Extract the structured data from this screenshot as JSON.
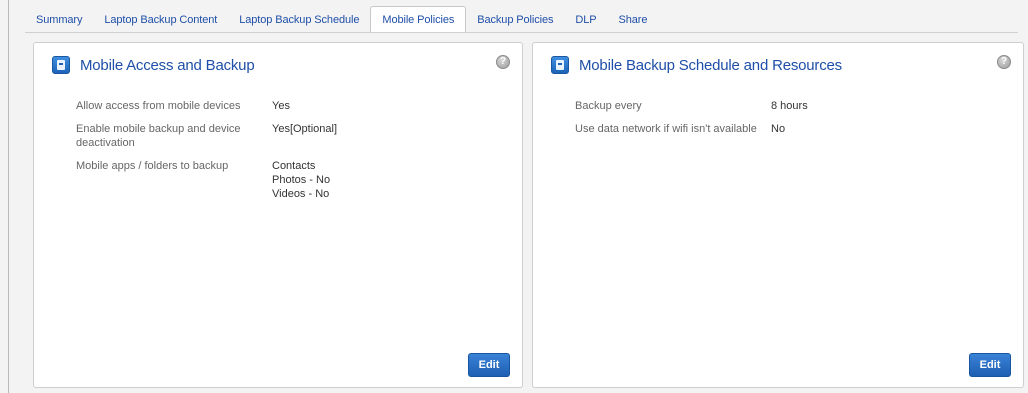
{
  "tabs": [
    {
      "label": "Summary",
      "active": false
    },
    {
      "label": "Laptop Backup Content",
      "active": false
    },
    {
      "label": "Laptop Backup Schedule",
      "active": false
    },
    {
      "label": "Mobile Policies",
      "active": true
    },
    {
      "label": "Backup Policies",
      "active": false
    },
    {
      "label": "DLP",
      "active": false
    },
    {
      "label": "Share",
      "active": false
    }
  ],
  "left_panel": {
    "title": "Mobile Access and Backup",
    "help_glyph": "?",
    "rows": [
      {
        "label": "Allow access from mobile devices",
        "values": [
          "Yes"
        ]
      },
      {
        "label": "Enable mobile backup and device deactivation",
        "values": [
          "Yes[Optional]"
        ]
      },
      {
        "label": "Mobile apps / folders to backup",
        "values": [
          "Contacts",
          "Photos - No",
          "Videos - No"
        ]
      }
    ],
    "edit_label": "Edit"
  },
  "right_panel": {
    "title": "Mobile Backup Schedule and Resources",
    "help_glyph": "?",
    "rows": [
      {
        "label": "Backup every",
        "values": [
          "8 hours"
        ]
      },
      {
        "label": "Use data network if wifi isn't available",
        "values": [
          "No"
        ]
      }
    ],
    "edit_label": "Edit"
  },
  "colors": {
    "tab_text": "#1f4fa8",
    "title": "#1f4fa8",
    "button": "#2b6fc6"
  },
  "icons": {
    "panel_icon": "mobile-device-icon",
    "help_icon": "help-icon"
  }
}
